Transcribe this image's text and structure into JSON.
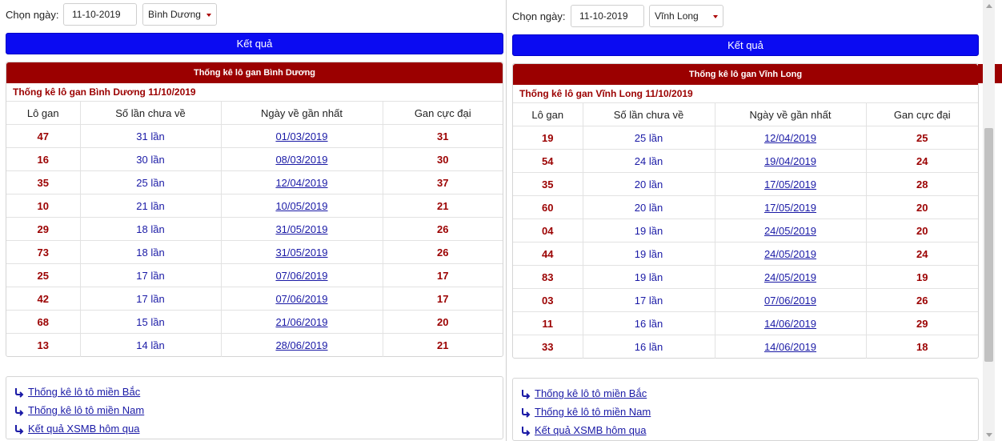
{
  "panels": [
    {
      "filter_label": "Chọn ngày:",
      "date_value": "11-10-2019",
      "province": "Bình Dương",
      "submit_label": "Kết quả",
      "header": "Thống kê lô gan Bình Dương",
      "subheader": "Thống kê lô gan Bình Dương 11/10/2019",
      "columns": [
        "Lô gan",
        "Số lần chưa về",
        "Ngày về gần nhất",
        "Gan cực đại"
      ],
      "rows": [
        {
          "lo": "47",
          "count": "31 lần",
          "date": "01/03/2019",
          "max": "31"
        },
        {
          "lo": "16",
          "count": "30 lần",
          "date": "08/03/2019",
          "max": "30"
        },
        {
          "lo": "35",
          "count": "25 lần",
          "date": "12/04/2019",
          "max": "37"
        },
        {
          "lo": "10",
          "count": "21 lần",
          "date": "10/05/2019",
          "max": "21"
        },
        {
          "lo": "29",
          "count": "18 lần",
          "date": "31/05/2019",
          "max": "26"
        },
        {
          "lo": "73",
          "count": "18 lần",
          "date": "31/05/2019",
          "max": "26"
        },
        {
          "lo": "25",
          "count": "17 lần",
          "date": "07/06/2019",
          "max": "17"
        },
        {
          "lo": "42",
          "count": "17 lần",
          "date": "07/06/2019",
          "max": "17"
        },
        {
          "lo": "68",
          "count": "15 lần",
          "date": "21/06/2019",
          "max": "20"
        },
        {
          "lo": "13",
          "count": "14 lần",
          "date": "28/06/2019",
          "max": "21"
        }
      ],
      "links": [
        "Thống kê lô tô miền Bắc",
        "Thống kê lô tô miền Nam",
        "Kết quả XSMB hôm qua"
      ]
    },
    {
      "filter_label": "Chọn ngày:",
      "date_value": "11-10-2019",
      "province": "Vĩnh Long",
      "submit_label": "Kết quả",
      "header": "Thống kê lô gan Vĩnh Long",
      "subheader": "Thống kê lô gan Vĩnh Long 11/10/2019",
      "columns": [
        "Lô gan",
        "Số lần chưa về",
        "Ngày về gần nhất",
        "Gan cực đại"
      ],
      "rows": [
        {
          "lo": "19",
          "count": "25 lần",
          "date": "12/04/2019",
          "max": "25"
        },
        {
          "lo": "54",
          "count": "24 lần",
          "date": "19/04/2019",
          "max": "24"
        },
        {
          "lo": "35",
          "count": "20 lần",
          "date": "17/05/2019",
          "max": "28"
        },
        {
          "lo": "60",
          "count": "20 lần",
          "date": "17/05/2019",
          "max": "20"
        },
        {
          "lo": "04",
          "count": "19 lần",
          "date": "24/05/2019",
          "max": "20"
        },
        {
          "lo": "44",
          "count": "19 lần",
          "date": "24/05/2019",
          "max": "24"
        },
        {
          "lo": "83",
          "count": "19 lần",
          "date": "24/05/2019",
          "max": "19"
        },
        {
          "lo": "03",
          "count": "17 lần",
          "date": "07/06/2019",
          "max": "26"
        },
        {
          "lo": "11",
          "count": "16 lần",
          "date": "14/06/2019",
          "max": "29"
        },
        {
          "lo": "33",
          "count": "16 lần",
          "date": "14/06/2019",
          "max": "18"
        }
      ],
      "links": [
        "Thống kê lô tô miền Bắc",
        "Thống kê lô tô miền Nam",
        "Kết quả XSMB hôm qua"
      ]
    }
  ],
  "colors": {
    "header_red": "#9b0000",
    "button_blue": "#0b0bf2",
    "link_blue": "#1a1aa6"
  },
  "icons": {
    "link_arrow": "curved-arrow-icon",
    "select_caret": "caret-down-icon"
  }
}
